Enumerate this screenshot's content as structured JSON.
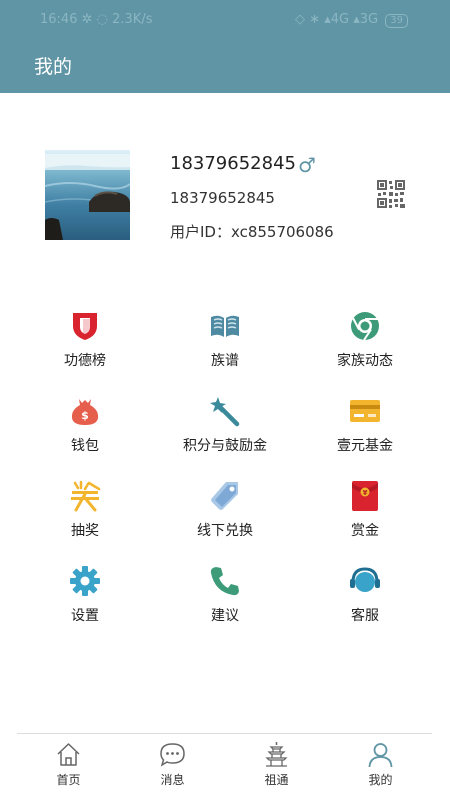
{
  "status_bar": {
    "time": "16:46",
    "speed": "2.3K/s",
    "network": "4G",
    "network2": "3G",
    "battery": "39"
  },
  "header": {
    "title": "我的"
  },
  "profile": {
    "name": "18379652845",
    "gender_symbol": "♂",
    "phone": "18379652845",
    "user_id": "用户ID：xc855706086"
  },
  "menu": {
    "items": [
      {
        "label": "功德榜",
        "icon": "shield-icon",
        "color": "#d9232e"
      },
      {
        "label": "族谱",
        "icon": "book-icon",
        "color": "#4e8ba3"
      },
      {
        "label": "家族动态",
        "icon": "chrome-icon",
        "color": "#3d9b7a"
      },
      {
        "label": "钱包",
        "icon": "money-bag-icon",
        "color": "#e65e4c"
      },
      {
        "label": "积分与鼓励金",
        "icon": "magic-wand-icon",
        "color": "#3a8a9c"
      },
      {
        "label": "壹元基金",
        "icon": "card-icon",
        "color": "#f3b52e"
      },
      {
        "label": "抽奖",
        "icon": "prize-icon",
        "color": "#f3b52e"
      },
      {
        "label": "线下兑换",
        "icon": "tag-icon",
        "color": "#7ea9d6"
      },
      {
        "label": "赏金",
        "icon": "red-envelope-icon",
        "color": "#d9232e"
      },
      {
        "label": "设置",
        "icon": "gear-icon",
        "color": "#3aa3c9"
      },
      {
        "label": "建议",
        "icon": "phone-icon",
        "color": "#3d9b7a"
      },
      {
        "label": "客服",
        "icon": "headset-icon",
        "color": "#3aa3c9"
      }
    ]
  },
  "tabbar": {
    "items": [
      {
        "label": "首页",
        "icon": "home-icon"
      },
      {
        "label": "消息",
        "icon": "message-icon"
      },
      {
        "label": "祖通",
        "icon": "pagoda-icon"
      },
      {
        "label": "我的",
        "icon": "user-icon",
        "active": true
      }
    ],
    "active_color": "#5f95a5"
  }
}
